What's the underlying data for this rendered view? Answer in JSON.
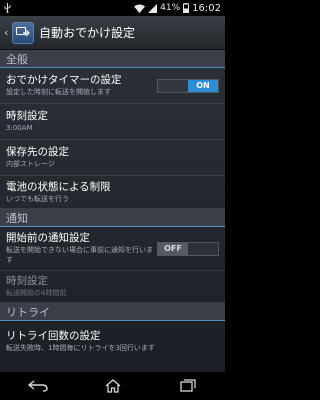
{
  "status_bar": {
    "battery_pct": "41%",
    "time": "16:02"
  },
  "action_bar": {
    "title": "自動おでかけ設定"
  },
  "sections": {
    "general": "全般",
    "notification": "通知",
    "retry": "リトライ"
  },
  "rows": {
    "timer": {
      "title": "おでかけタイマーの設定",
      "sub": "設定した時刻に転送を開始します",
      "toggle_on": "ON",
      "toggle_off": ""
    },
    "time_setting": {
      "title": "時刻設定",
      "sub": "3:00AM"
    },
    "save_location": {
      "title": "保存先の設定",
      "sub": "内部ストレージ"
    },
    "battery_limit": {
      "title": "電池の状態による制限",
      "sub": "いつでも転送を行う"
    },
    "pre_notify": {
      "title": "開始前の通知設定",
      "sub": "転送を開始できない場合に事前に通知を行います",
      "toggle_off": "OFF",
      "toggle_on": ""
    },
    "notify_time": {
      "title": "時刻設定",
      "sub": "転送開始の4時間前"
    },
    "retry_count": {
      "title": "リトライ回数の設定",
      "sub": "転送失敗時、1時間毎にリトライを3回行います"
    }
  }
}
